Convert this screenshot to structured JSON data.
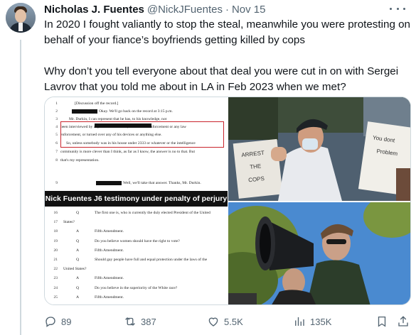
{
  "author": {
    "name": "Nicholas J. Fuentes",
    "handle": "@NickJFuentes",
    "separator": "·",
    "date": "Nov 15"
  },
  "tweet": {
    "paragraph1": "In 2020 I fought valiantly to stop the steal, meanwhile you were protesting on behalf of your fiance’s boyfriends getting killed by cops",
    "paragraph2": "Why don’t you tell everyone about that deal you were cut in on with Sergei Lavrov that you told me about in LA in Feb 2023 when we met?"
  },
  "media": {
    "document": {
      "top_lines": [
        {
          "num": "1",
          "text": "[Discussion off the record.]"
        },
        {
          "num": "2",
          "text": "Okay.   We'll go back on the record at 3:15 p.m."
        },
        {
          "num": "3",
          "text": "Mr. Durkin,                              I can represent that he has, to his knowledge, not"
        },
        {
          "num": "4",
          "text": "been interviewed by any law enforcement, Federal law enforcement or any law"
        },
        {
          "num": "5",
          "text": "enforcement, or turned over any of his devices or anything else."
        },
        {
          "num": "6",
          "text": "So, unless somebody was in his house under 2333 or whatever or the intelligence"
        },
        {
          "num": "7",
          "text": "community is more clever than I think, as far as I know, the answer is no to that.   But"
        },
        {
          "num": "8",
          "text": "that's my representation."
        },
        {
          "num": "9",
          "text": "Well, we'll take that answer.   Thanks, Mr. Durkin."
        }
      ],
      "banner": "Nick Fuentes J6 testimony under penalty of perjury",
      "bottom_lines": [
        {
          "num": "16",
          "mark": "Q",
          "text": "The first one is, who is currently the duly elected President of the United"
        },
        {
          "num": "17",
          "mark": "",
          "text": "States?"
        },
        {
          "num": "18",
          "mark": "A",
          "text": "Fifth Amendment."
        },
        {
          "num": "19",
          "mark": "Q",
          "text": "Do you believe women should have the right to vote?"
        },
        {
          "num": "20",
          "mark": "A",
          "text": "Fifth Amendment."
        },
        {
          "num": "21",
          "mark": "Q",
          "text": "Should gay people have full and equal protection under the laws of the"
        },
        {
          "num": "22",
          "mark": "",
          "text": "United States?"
        },
        {
          "num": "23",
          "mark": "A",
          "text": "Fifth Amendment."
        },
        {
          "num": "24",
          "mark": "Q",
          "text": "Do you believe in the superiority of the White race?"
        },
        {
          "num": "25",
          "mark": "A",
          "text": "Fifth Amendment."
        }
      ]
    },
    "photo1_signs": {
      "sign_left_line1": "ARREST",
      "sign_left_line2": "THE",
      "sign_left_line3": "COPS",
      "sign_right_line1": "You dont",
      "sign_right_line2": "Problem"
    }
  },
  "actions": {
    "replies": "89",
    "reposts": "387",
    "likes": "5.5K",
    "views": "135K"
  },
  "colors": {
    "text_primary": "#0f1419",
    "text_secondary": "#536471",
    "border": "#cfd9de",
    "highlight_box": "#c9252d"
  }
}
